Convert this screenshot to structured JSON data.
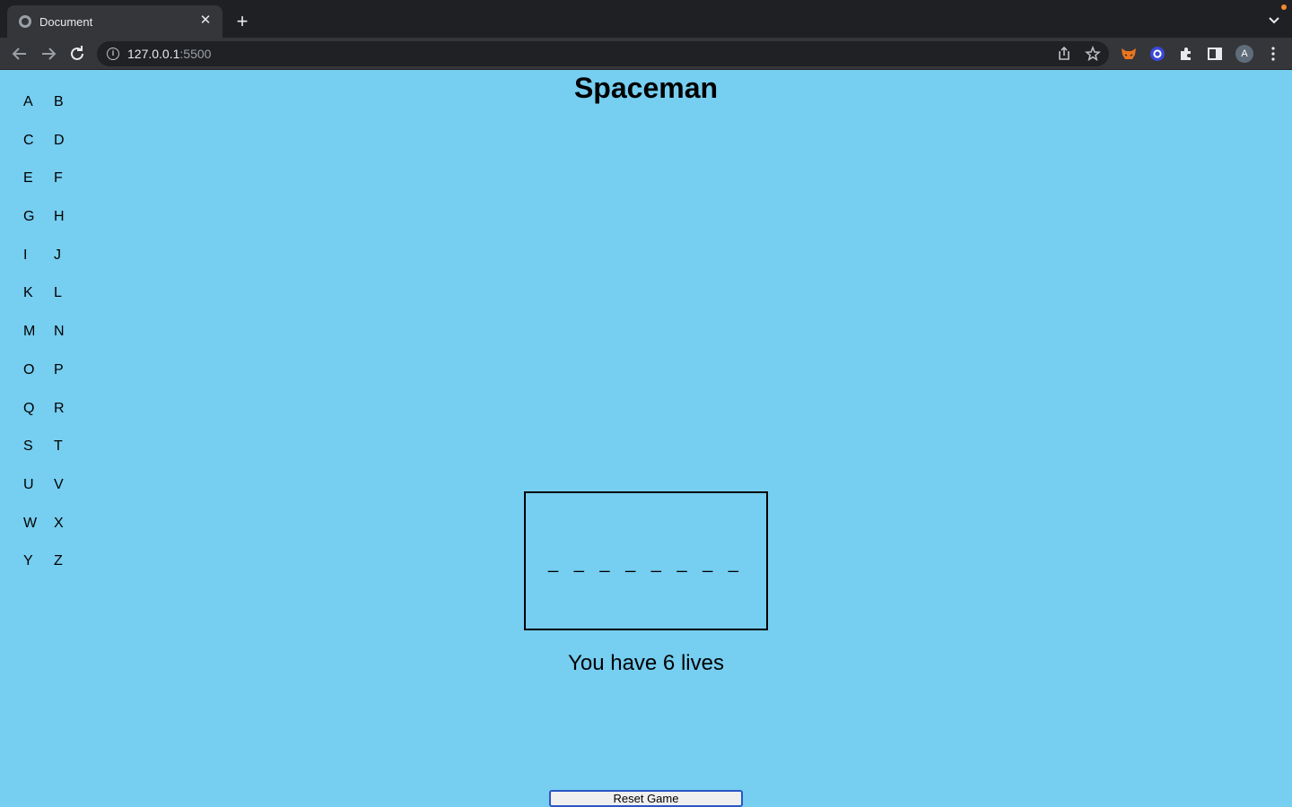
{
  "browser": {
    "tab_title": "Document",
    "tab_close": "✕",
    "new_tab": "+",
    "url_host": "127.0.0.1",
    "url_port": ":5500",
    "profile_initial": "A",
    "icons": [
      "globe-icon",
      "back-icon",
      "forward-icon",
      "reload-icon",
      "info-icon",
      "share-icon",
      "star-icon",
      "fox-extension-icon",
      "circle-extension-icon",
      "puzzle-icon",
      "sidepanel-icon",
      "menu-icon",
      "tab-search-icon"
    ]
  },
  "page": {
    "title": "Spaceman",
    "letters": [
      "A",
      "B",
      "C",
      "D",
      "E",
      "F",
      "G",
      "H",
      "I",
      "J",
      "K",
      "L",
      "M",
      "N",
      "O",
      "P",
      "Q",
      "R",
      "S",
      "T",
      "U",
      "V",
      "W",
      "X",
      "Y",
      "Z"
    ],
    "word_blanks": "_ _ _ _ _ _ _ _",
    "lives_text": "You have 6 lives",
    "reset_label": "Reset Game",
    "colors": {
      "background": "#76cef0",
      "reset_border": "#2b57c5"
    }
  }
}
